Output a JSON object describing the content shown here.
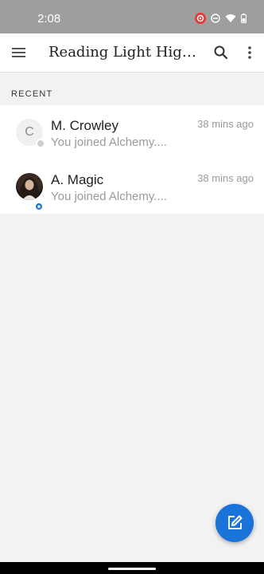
{
  "status_bar": {
    "time": "2:08",
    "icons": [
      "record-icon",
      "do-not-disturb-icon",
      "wifi-icon",
      "battery-icon"
    ]
  },
  "app_bar": {
    "title": "Reading Light High Sc...",
    "icons": [
      "menu-icon",
      "search-icon",
      "more-vert-icon"
    ]
  },
  "section": {
    "label": "RECENT"
  },
  "conversations": [
    {
      "avatar_initial": "C",
      "name": "M. Crowley",
      "preview": "You joined Alchemy....",
      "time": "38 mins ago"
    },
    {
      "name": "A. Magic",
      "preview": "You joined Alchemy....",
      "time": "38 mins ago"
    }
  ],
  "fab": {
    "icon": "compose-icon"
  },
  "colors": {
    "accent": "#1a73d9",
    "status_bar": "#9e9e9e",
    "background": "#f2f2f2",
    "record_red": "#e53935"
  }
}
